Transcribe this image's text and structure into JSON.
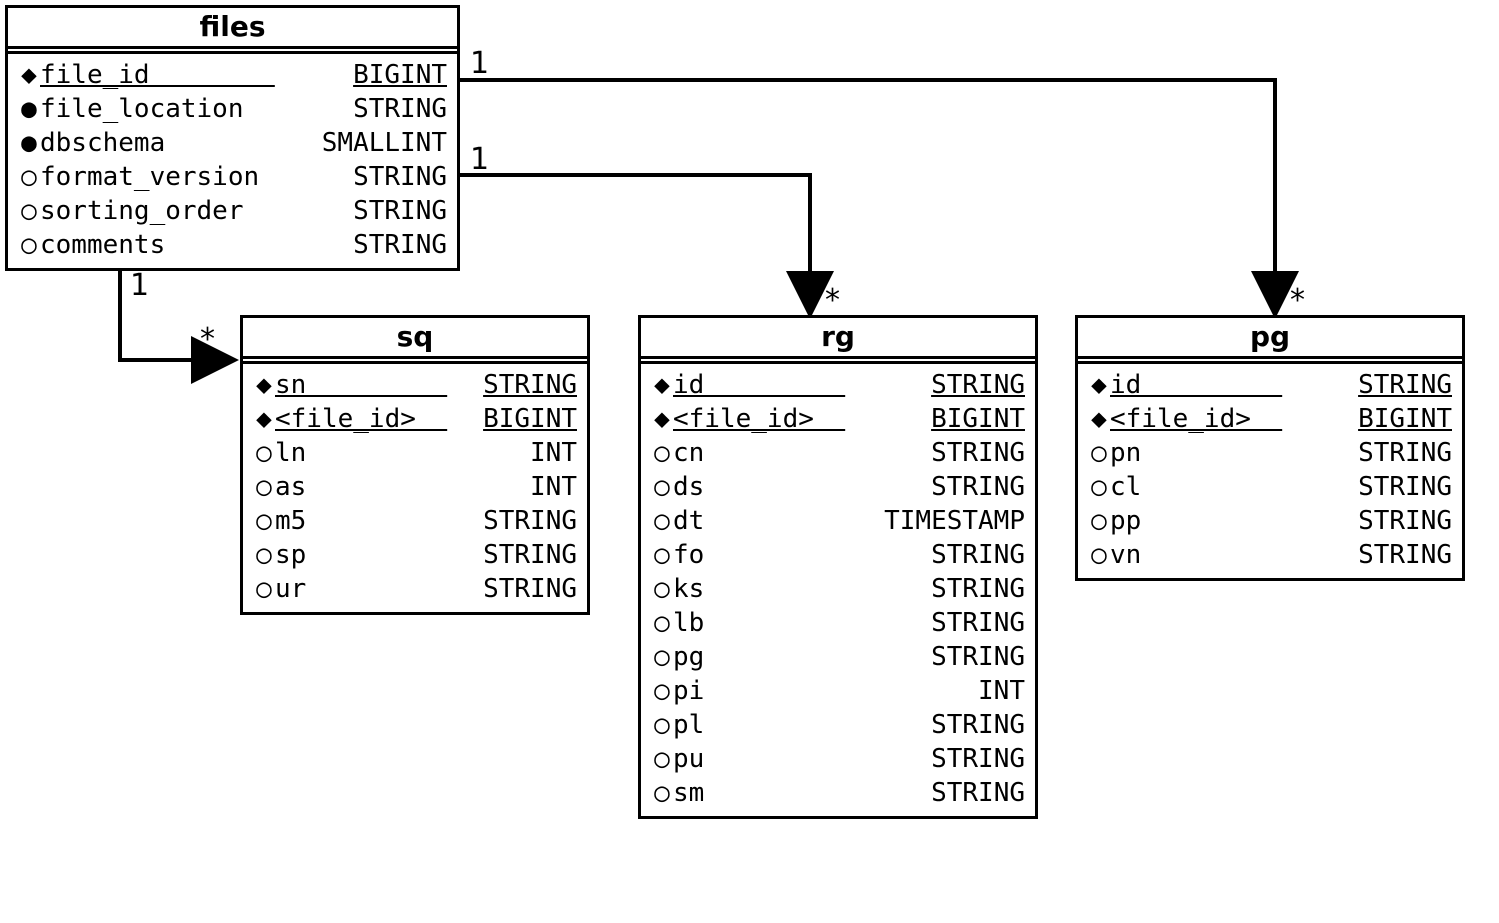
{
  "entities": {
    "files": {
      "title": "files",
      "cols": [
        {
          "mark": "◆",
          "name": "file_id",
          "type": "BIGINT",
          "pk": true
        },
        {
          "mark": "●",
          "name": "file_location",
          "type": "STRING"
        },
        {
          "mark": "●",
          "name": "dbschema",
          "type": "SMALLINT"
        },
        {
          "mark": "○",
          "name": "format_version",
          "type": "STRING"
        },
        {
          "mark": "○",
          "name": "sorting_order",
          "type": "STRING"
        },
        {
          "mark": "○",
          "name": "comments",
          "type": "STRING"
        }
      ]
    },
    "sq": {
      "title": "sq",
      "cols": [
        {
          "mark": "◆",
          "name": "sn",
          "type": "STRING",
          "pk": true
        },
        {
          "mark": "◆",
          "name": "<file_id>",
          "type": "BIGINT",
          "pk": true
        },
        {
          "mark": "○",
          "name": "ln",
          "type": "INT"
        },
        {
          "mark": "○",
          "name": "as",
          "type": "INT"
        },
        {
          "mark": "○",
          "name": "m5",
          "type": "STRING"
        },
        {
          "mark": "○",
          "name": "sp",
          "type": "STRING"
        },
        {
          "mark": "○",
          "name": "ur",
          "type": "STRING"
        }
      ]
    },
    "rg": {
      "title": "rg",
      "cols": [
        {
          "mark": "◆",
          "name": "id",
          "type": "STRING",
          "pk": true
        },
        {
          "mark": "◆",
          "name": "<file_id>",
          "type": "BIGINT",
          "pk": true
        },
        {
          "mark": "○",
          "name": "cn",
          "type": "STRING"
        },
        {
          "mark": "○",
          "name": "ds",
          "type": "STRING"
        },
        {
          "mark": "○",
          "name": "dt",
          "type": "TIMESTAMP"
        },
        {
          "mark": "○",
          "name": "fo",
          "type": "STRING"
        },
        {
          "mark": "○",
          "name": "ks",
          "type": "STRING"
        },
        {
          "mark": "○",
          "name": "lb",
          "type": "STRING"
        },
        {
          "mark": "○",
          "name": "pg",
          "type": "STRING"
        },
        {
          "mark": "○",
          "name": "pi",
          "type": "INT"
        },
        {
          "mark": "○",
          "name": "pl",
          "type": "STRING"
        },
        {
          "mark": "○",
          "name": "pu",
          "type": "STRING"
        },
        {
          "mark": "○",
          "name": "sm",
          "type": "STRING"
        }
      ]
    },
    "pg": {
      "title": "pg",
      "cols": [
        {
          "mark": "◆",
          "name": "id",
          "type": "STRING",
          "pk": true
        },
        {
          "mark": "◆",
          "name": "<file_id>",
          "type": "BIGINT",
          "pk": true
        },
        {
          "mark": "○",
          "name": "pn",
          "type": "STRING"
        },
        {
          "mark": "○",
          "name": "cl",
          "type": "STRING"
        },
        {
          "mark": "○",
          "name": "pp",
          "type": "STRING"
        },
        {
          "mark": "○",
          "name": "vn",
          "type": "STRING"
        }
      ]
    }
  },
  "relationships": [
    {
      "from": "files",
      "to": "sq",
      "parent_card": "1",
      "child_card": "*"
    },
    {
      "from": "files",
      "to": "rg",
      "parent_card": "1",
      "child_card": "*"
    },
    {
      "from": "files",
      "to": "pg",
      "parent_card": "1",
      "child_card": "*"
    }
  ],
  "labels": {
    "files_sq_parent": "1",
    "files_sq_child": "*",
    "files_rg_parent": "1",
    "files_rg_child": "*",
    "files_pg_parent": "1",
    "files_pg_child": "*"
  }
}
